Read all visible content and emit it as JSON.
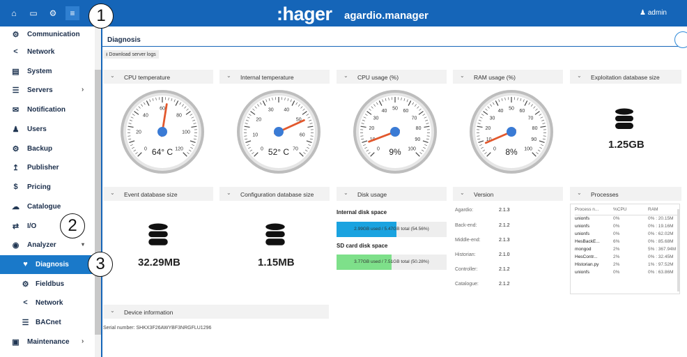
{
  "app": {
    "brand": ":hager",
    "product": "agardio.manager",
    "user": "admin"
  },
  "callouts": [
    "1",
    "2",
    "3"
  ],
  "sidebar": {
    "items": [
      {
        "label": "Communication",
        "icon": "cogs-icon"
      },
      {
        "label": "Network",
        "icon": "share-icon"
      },
      {
        "label": "System",
        "icon": "system-icon"
      },
      {
        "label": "Servers",
        "icon": "servers-icon"
      },
      {
        "label": "Notification",
        "icon": "envelope-icon"
      },
      {
        "label": "Users",
        "icon": "users-icon"
      },
      {
        "label": "Backup",
        "icon": "cogs-icon"
      },
      {
        "label": "Publisher",
        "icon": "upload-icon"
      },
      {
        "label": "Pricing",
        "icon": "dollar-icon"
      },
      {
        "label": "Catalogue",
        "icon": "cloud-icon"
      },
      {
        "label": "I/O",
        "icon": "arrows-icon"
      },
      {
        "label": "Analyzer",
        "icon": "eye-icon"
      },
      {
        "label": "Diagnosis",
        "icon": "heartbeat-icon"
      },
      {
        "label": "Fieldbus",
        "icon": "sitemap-icon"
      },
      {
        "label": "Network",
        "icon": "share-icon"
      },
      {
        "label": "BACnet",
        "icon": "servers-icon"
      },
      {
        "label": "Maintenance",
        "icon": "toolbox-icon"
      }
    ]
  },
  "page": {
    "title": "Diagnosis",
    "download_label": "Download server logs"
  },
  "panels": {
    "cpu_temp": "CPU temperature",
    "internal_temp": "Internal temperature",
    "cpu_usage": "CPU usage (%)",
    "ram_usage": "RAM usage (%)",
    "expl_db": "Exploitation database size",
    "event_db": "Event database size",
    "config_db": "Configuration database size",
    "disk": "Disk usage",
    "version": "Version",
    "processes": "Processes",
    "device": "Device information"
  },
  "gauges": [
    {
      "value_text": "64° C",
      "value": 64,
      "min": 0,
      "max": 120,
      "ticks": [
        "0",
        "20",
        "40",
        "60",
        "80",
        "100",
        "120"
      ]
    },
    {
      "value_text": "52° C",
      "value": 52,
      "min": 0,
      "max": 70,
      "ticks": [
        "0",
        "10",
        "20",
        "30",
        "40",
        "50",
        "60",
        "70"
      ]
    },
    {
      "value_text": "9%",
      "value": 9,
      "min": 0,
      "max": 100,
      "ticks": [
        "0",
        "10",
        "20",
        "30",
        "40",
        "50",
        "60",
        "70",
        "80",
        "90",
        "100"
      ]
    },
    {
      "value_text": "8%",
      "value": 8,
      "min": 0,
      "max": 100,
      "ticks": [
        "0",
        "10",
        "20",
        "30",
        "40",
        "50",
        "60",
        "70",
        "80",
        "90",
        "100"
      ]
    }
  ],
  "databases": {
    "exploitation": "1.25GB",
    "event": "32.29MB",
    "configuration": "1.15MB"
  },
  "disk": {
    "internal_label": "Internal disk space",
    "internal_text": "2.99GB used / 5.47GB total (54.56%)",
    "internal_pct": 54.56,
    "internal_color": "#1aa3e0",
    "sd_label": "SD card disk space",
    "sd_text": "3.77GB used / 7.51GB total (50.28%)",
    "sd_pct": 50.28,
    "sd_color": "#7ee08a"
  },
  "version": [
    {
      "name": "Agardio:",
      "value": "2.1.3"
    },
    {
      "name": "Back-end:",
      "value": "2.1.2"
    },
    {
      "name": "Middle-end:",
      "value": "2.1.3"
    },
    {
      "name": "Historian:",
      "value": "2.1.0"
    },
    {
      "name": "Controller:",
      "value": "2.1.2"
    },
    {
      "name": "Catalogue:",
      "value": "2.1.2"
    }
  ],
  "processes": {
    "headers": [
      "Process n...",
      "%CPU",
      "RAM"
    ],
    "rows": [
      [
        "unionfs",
        "0%",
        "0% : 20.15M"
      ],
      [
        "unionfs",
        "0%",
        "0% : 19.16M"
      ],
      [
        "unionfs",
        "0%",
        "0% : 62.02M"
      ],
      [
        "HesBackE...",
        "6%",
        "0% : 85.68M"
      ],
      [
        "mongod",
        "2%",
        "5% : 367.94M"
      ],
      [
        "HesContr...",
        "2%",
        "0% : 32.45M"
      ],
      [
        "Historian.py",
        "2%",
        "1% : 97.52M"
      ],
      [
        "unionfs",
        "0%",
        "0% : 63.86M"
      ]
    ]
  },
  "device": {
    "serial_label": "Serial number:",
    "serial_value": "SHKX3F26AWYBF3NRGFLU1296"
  }
}
